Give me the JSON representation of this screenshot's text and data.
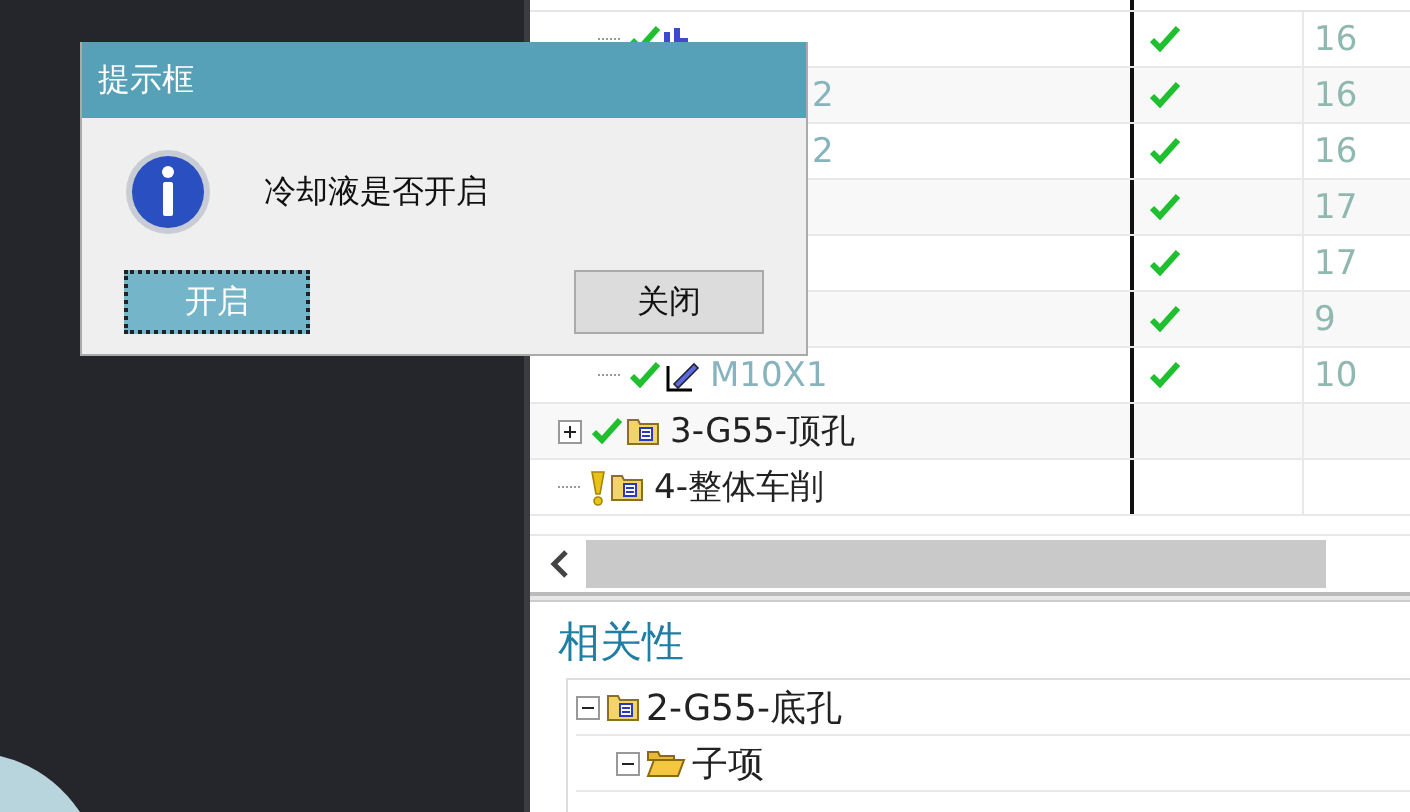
{
  "tree": {
    "rows": [
      {
        "kind": "tool",
        "done": true,
        "count": "16"
      },
      {
        "kind": "tail",
        "name": "2",
        "done": true,
        "count": "16"
      },
      {
        "kind": "tail",
        "name": "2",
        "done": true,
        "count": "16"
      },
      {
        "kind": "blank",
        "done": true,
        "count": "17"
      },
      {
        "kind": "blank",
        "done": true,
        "count": "17"
      },
      {
        "kind": "blank",
        "done": true,
        "count": "9"
      },
      {
        "kind": "edit",
        "name": "M10X1",
        "done": true,
        "count": "10"
      },
      {
        "kind": "group",
        "name": "3-G55-顶孔",
        "expanded": false,
        "complete": true
      },
      {
        "kind": "group",
        "name": "4-整体车削",
        "complete": false
      }
    ]
  },
  "related": {
    "title": "相关性",
    "items": [
      {
        "kind": "group",
        "name": "2-G55-底孔",
        "expanded": true,
        "children": [
          {
            "kind": "folder",
            "name": "子项",
            "expanded": true
          }
        ]
      }
    ]
  },
  "dialog": {
    "title": "提示框",
    "message": "冷却液是否开启",
    "buttons": [
      {
        "label": "开启",
        "focused": true
      },
      {
        "label": "关闭",
        "focused": false
      }
    ]
  }
}
